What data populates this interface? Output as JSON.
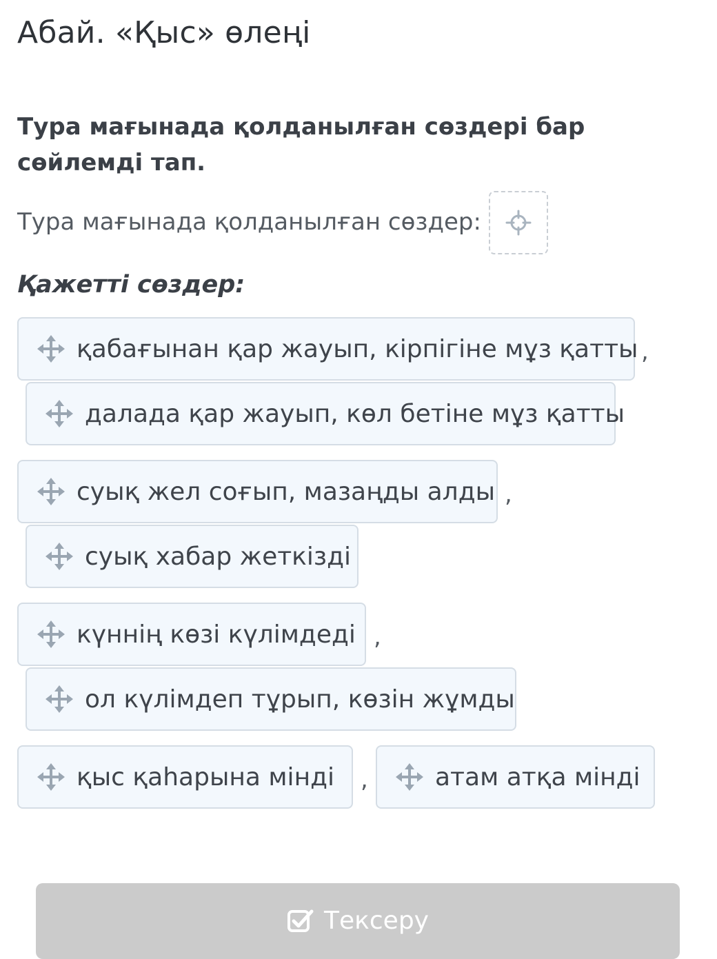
{
  "title": "Абай. «Қыс» өлеңі",
  "question": "Тура мағынада қолданылған сөздері бар сөйлемді тап.",
  "drop_prompt": "Тура мағынада қолданылған сөздер:",
  "words_label": "Қажетті сөздер:",
  "comma": ",",
  "options": [
    "қабағынан қар жауып, кірпігіне мұз қатты",
    "далада қар жауып, көл бетіне мұз қатты",
    "суық жел соғып, мазаңды алды",
    "суық хабар жеткізді",
    "күннің көзі күлімдеді",
    "ол күлімдеп тұрып, көзін жұмды",
    "қыс қаһарына мінді",
    "атам атқа мінді"
  ],
  "check_button": "Тексеру",
  "icons": {
    "drag": "move-arrows-icon",
    "drop_target": "crosshair-target-icon",
    "check": "checkbox-check-icon"
  },
  "colors": {
    "chip_bg": "#f3f8fd",
    "chip_border": "#d5dde5",
    "icon": "#9aa6b2",
    "button_bg": "#cbcbcb"
  }
}
